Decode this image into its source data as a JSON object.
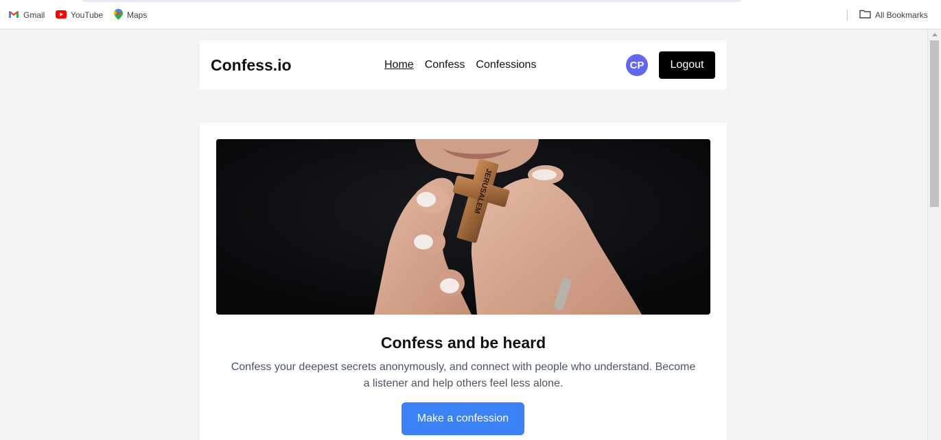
{
  "bookmarks": {
    "items": [
      {
        "label": "Gmail",
        "icon": "gmail-icon"
      },
      {
        "label": "YouTube",
        "icon": "youtube-icon"
      },
      {
        "label": "Maps",
        "icon": "maps-icon"
      }
    ],
    "all_label": "All Bookmarks"
  },
  "navbar": {
    "brand": "Confess.io",
    "links": [
      "Home",
      "Confess",
      "Confessions"
    ],
    "avatar_initials": "CP",
    "logout_label": "Logout"
  },
  "hero": {
    "image_text": "JERUSALEM",
    "title": "Confess and be heard",
    "description": "Confess your deepest secrets anonymously, and connect with people who understand. Become a listener and help others feel less alone.",
    "cta_label": "Make a confession"
  },
  "colors": {
    "page_background": "#f3f3f3",
    "avatar": "#6366f1",
    "cta": "#3b82f6",
    "logout": "#000000"
  }
}
